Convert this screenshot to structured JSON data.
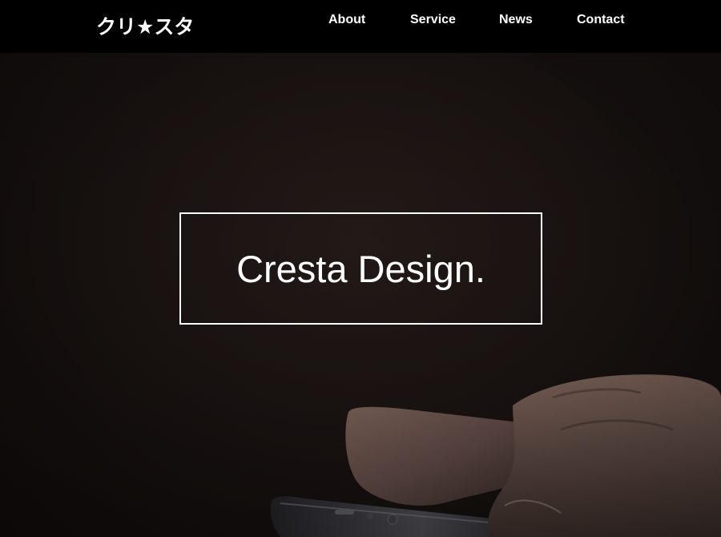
{
  "header": {
    "logo_text": "クリ★スタ",
    "nav": [
      {
        "label": "About"
      },
      {
        "label": "Service"
      },
      {
        "label": "News"
      },
      {
        "label": "Contact"
      }
    ]
  },
  "hero": {
    "title": "Cresta Design.",
    "image_subject": "hands-holding-smartphone"
  },
  "colors": {
    "header_bg": "#000000",
    "hero_bg": "#1c1513",
    "text": "#ffffff"
  }
}
